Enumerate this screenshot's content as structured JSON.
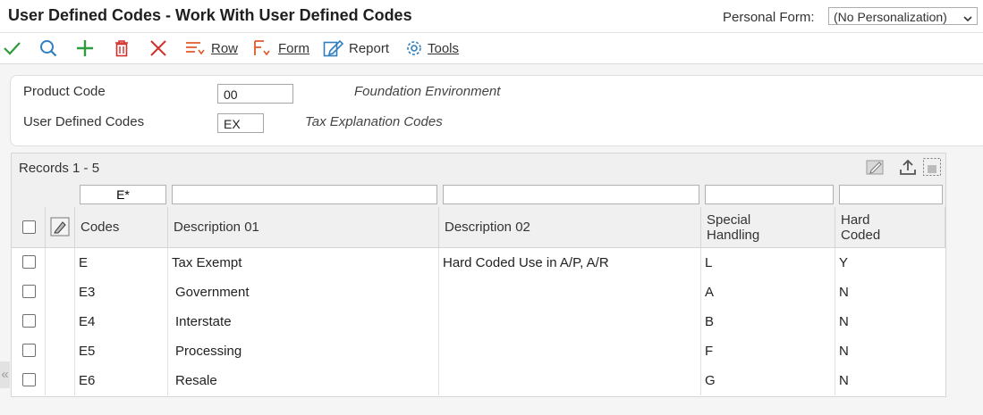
{
  "window": {
    "title": "User Defined Codes - Work With User Defined Codes",
    "personal_form_label": "Personal Form:",
    "personal_form_value": "(No Personalization)"
  },
  "toolbar": {
    "row_label": "Row",
    "form_label": "Form",
    "report_label": "Report",
    "tools_label": "Tools"
  },
  "header": {
    "product_code_label": "Product Code",
    "product_code_value": "00",
    "product_code_desc": "Foundation Environment",
    "udc_label": "User Defined Codes",
    "udc_value": "EX",
    "udc_desc": "Tax Explanation Codes"
  },
  "grid": {
    "records_label": "Records 1 - 5",
    "qbe": {
      "codes": "E*",
      "desc01": "",
      "desc02": "",
      "special": "",
      "hard": ""
    },
    "columns": {
      "codes": "Codes",
      "desc01": "Description 01",
      "desc02": "Description 02",
      "special_1": "Special",
      "special_2": "Handling",
      "hard_1": "Hard",
      "hard_2": "Coded"
    },
    "rows": [
      {
        "code": "E",
        "desc01": "Tax Exempt",
        "desc02": "Hard Coded Use in A/P, A/R",
        "special": "L",
        "hard": "Y"
      },
      {
        "code": "E3",
        "desc01": "Government",
        "desc02": "",
        "special": "A",
        "hard": "N"
      },
      {
        "code": "E4",
        "desc01": "Interstate",
        "desc02": "",
        "special": "B",
        "hard": "N"
      },
      {
        "code": "E5",
        "desc01": "Processing",
        "desc02": "",
        "special": "F",
        "hard": "N"
      },
      {
        "code": "E6",
        "desc01": "Resale",
        "desc02": "",
        "special": "G",
        "hard": "N"
      }
    ]
  },
  "colors": {
    "accent_green": "#2e9b3c",
    "accent_blue": "#2f7fc1",
    "delete_red": "#d0312d"
  }
}
